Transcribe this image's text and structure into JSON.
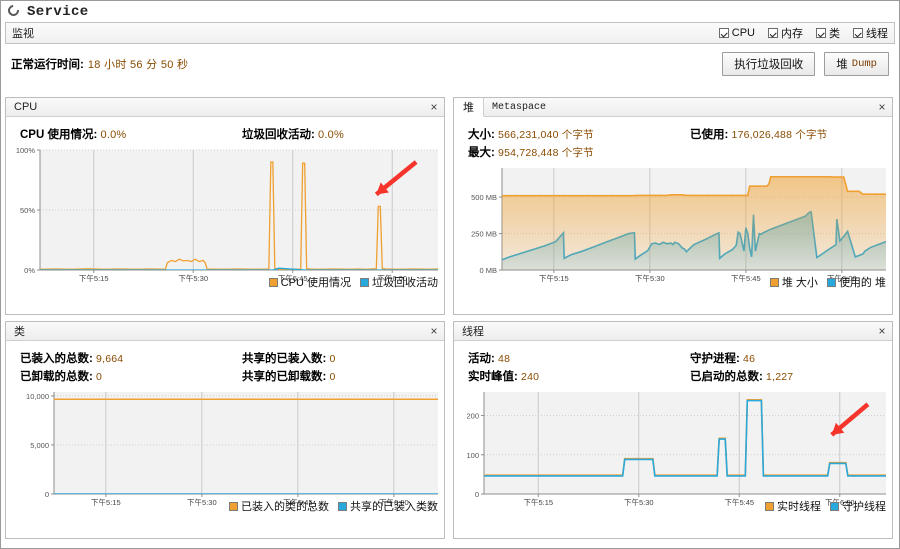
{
  "window": {
    "title": "Service",
    "icon": "process-circle-icon"
  },
  "monitor_bar": {
    "title": "监视",
    "checkboxes": [
      {
        "label": "CPU",
        "checked": true
      },
      {
        "label": "内存",
        "checked": true
      },
      {
        "label": "类",
        "checked": true
      },
      {
        "label": "线程",
        "checked": true
      }
    ]
  },
  "uptime": {
    "label": "正常运行时间:",
    "value": "18 小时 56 分 50 秒"
  },
  "toolbar": {
    "gc_button": "执行垃圾回收",
    "heap_dump_button": "堆",
    "heap_dump_button_mono": "Dump"
  },
  "colors": {
    "orange": "#f0a030",
    "orange_line": "#e8971c",
    "blue": "#29a8db",
    "blue_line": "#1f9ed4",
    "arrow_red": "#f5342b",
    "value_text": "#8a4b00",
    "plot_bg": "#f2f2f2",
    "grid": "#d8d8d8"
  },
  "panels": {
    "cpu": {
      "header": "CPU",
      "close": "×",
      "stats": [
        {
          "label": "CPU 使用情况:",
          "value": "0.0%"
        },
        {
          "label": "垃圾回收活动:",
          "value": "0.0%"
        }
      ],
      "legend": [
        {
          "label": "CPU 使用情况",
          "color": "#f0a030"
        },
        {
          "label": "垃圾回收活动",
          "color": "#29a8db"
        }
      ]
    },
    "heap": {
      "tab_active": "堆",
      "tab_inactive": "Metaspace",
      "close": "×",
      "stats": [
        {
          "label": "大小:",
          "value": "566,231,040 个字节"
        },
        {
          "label": "已使用:",
          "value": "176,026,488 个字节"
        },
        {
          "label": "最大:",
          "value": "954,728,448 个字节"
        },
        {
          "label": "",
          "value": ""
        }
      ],
      "legend": [
        {
          "label": "堆 大小",
          "color": "#f0a030"
        },
        {
          "label": "使用的 堆",
          "color": "#29a8db"
        }
      ]
    },
    "classes": {
      "header": "类",
      "close": "×",
      "stats": [
        {
          "label": "已装入的总数:",
          "value": "9,664"
        },
        {
          "label": "共享的已装入数:",
          "value": "0"
        },
        {
          "label": "已卸载的总数:",
          "value": "0"
        },
        {
          "label": "共享的已卸载数:",
          "value": "0"
        }
      ],
      "legend": [
        {
          "label": "已装入的类的总数",
          "color": "#f0a030"
        },
        {
          "label": "共享的已装入类数",
          "color": "#29a8db"
        }
      ]
    },
    "threads": {
      "header": "线程",
      "close": "×",
      "stats": [
        {
          "label": "活动:",
          "value": "48"
        },
        {
          "label": "守护进程:",
          "value": "46"
        },
        {
          "label": "实时峰值:",
          "value": "240"
        },
        {
          "label": "已启动的总数:",
          "value": "1,227"
        }
      ],
      "legend": [
        {
          "label": "实时线程",
          "color": "#f0a030"
        },
        {
          "label": "守护线程",
          "color": "#29a8db"
        }
      ]
    }
  },
  "chart_data": [
    {
      "id": "cpu",
      "type": "area",
      "title": "CPU",
      "xlabel": "",
      "ylabel": "",
      "ytick_labels": [
        "0%",
        "50%",
        "100%"
      ],
      "ytick_values": [
        0,
        50,
        100
      ],
      "ylim": [
        0,
        100
      ],
      "xtick_labels": [
        "下午5:15",
        "下午5:30",
        "下午5:45",
        "下午6:00"
      ],
      "xtick_positions": [
        0.135,
        0.385,
        0.635,
        0.885
      ],
      "grid": true,
      "legend_position": "bottom-right",
      "series": [
        {
          "name": "CPU 使用情况",
          "color": "#f0a030",
          "x": [
            0.0,
            0.04,
            0.08,
            0.12,
            0.16,
            0.2,
            0.24,
            0.28,
            0.315,
            0.32,
            0.33,
            0.34,
            0.35,
            0.36,
            0.37,
            0.38,
            0.39,
            0.4,
            0.41,
            0.415,
            0.42,
            0.46,
            0.5,
            0.54,
            0.575,
            0.58,
            0.585,
            0.59,
            0.6,
            0.605,
            0.61,
            0.62,
            0.63,
            0.655,
            0.66,
            0.665,
            0.67,
            0.68,
            0.7,
            0.74,
            0.78,
            0.8,
            0.82,
            0.845,
            0.85,
            0.855,
            0.86,
            0.87,
            0.9,
            0.94,
            0.98,
            1.0
          ],
          "y": [
            0.6,
            0.8,
            0.6,
            1.0,
            0.6,
            0.8,
            0.6,
            0.8,
            0.6,
            6.0,
            8.0,
            7.0,
            9.0,
            7.5,
            8.0,
            7.0,
            9.0,
            7.0,
            8.0,
            6.0,
            0.8,
            0.6,
            0.8,
            0.6,
            0.8,
            90.0,
            90.0,
            1.2,
            0.6,
            0.8,
            0.6,
            0.8,
            0.6,
            0.8,
            89.0,
            89.0,
            1.0,
            0.8,
            0.6,
            0.8,
            0.6,
            0.8,
            0.6,
            1.0,
            53.0,
            53.0,
            1.2,
            0.8,
            0.6,
            0.8,
            0.6,
            0.8
          ]
        },
        {
          "name": "垃圾回收活动",
          "color": "#29a8db",
          "x": [
            0.0,
            0.25,
            0.5,
            0.585,
            0.6,
            0.665,
            0.75,
            0.85,
            1.0
          ],
          "y": [
            0.0,
            0.0,
            0.0,
            0.0,
            1.5,
            0.0,
            0.0,
            0.0,
            0.0
          ]
        }
      ],
      "annotations": [
        {
          "type": "arrow",
          "color": "#f5342b",
          "from": [
            0.945,
            0.9
          ],
          "to": [
            0.845,
            0.63
          ]
        }
      ]
    },
    {
      "id": "heap",
      "type": "area",
      "title": "堆",
      "ytick_labels": [
        "0 MB",
        "250 MB",
        "500 MB"
      ],
      "ytick_values": [
        0,
        250,
        500
      ],
      "ylim": [
        0,
        700
      ],
      "xtick_labels": [
        "下午5:15",
        "下午5:30",
        "下午5:45",
        "下午6:00"
      ],
      "xtick_positions": [
        0.135,
        0.385,
        0.635,
        0.885
      ],
      "grid": true,
      "legend_position": "bottom-right",
      "series": [
        {
          "name": "堆 大小",
          "color": "#f0a030",
          "x": [
            0.0,
            0.1,
            0.2,
            0.3,
            0.345,
            0.35,
            0.4,
            0.43,
            0.44,
            0.47,
            0.48,
            0.52,
            0.56,
            0.595,
            0.6,
            0.605,
            0.64,
            0.645,
            0.65,
            0.69,
            0.695,
            0.7,
            0.76,
            0.8,
            0.84,
            0.845,
            0.85,
            0.855,
            0.86,
            0.89,
            0.9,
            0.93,
            0.94,
            1.0
          ],
          "y": [
            510,
            510,
            510,
            510,
            510,
            512,
            512,
            512,
            516,
            516,
            512,
            512,
            512,
            512,
            512,
            512,
            512,
            575,
            575,
            575,
            590,
            640,
            640,
            640,
            640,
            640,
            640,
            640,
            638,
            638,
            540,
            540,
            520,
            520
          ]
        },
        {
          "name": "使用的 堆",
          "color": "#29a8db",
          "x": [
            0.0,
            0.02,
            0.05,
            0.08,
            0.11,
            0.14,
            0.16,
            0.162,
            0.18,
            0.21,
            0.24,
            0.27,
            0.3,
            0.33,
            0.345,
            0.347,
            0.36,
            0.375,
            0.38,
            0.39,
            0.4,
            0.41,
            0.42,
            0.43,
            0.44,
            0.445,
            0.45,
            0.46,
            0.47,
            0.475,
            0.48,
            0.49,
            0.5,
            0.53,
            0.56,
            0.565,
            0.567,
            0.58,
            0.6,
            0.61,
            0.615,
            0.62,
            0.63,
            0.635,
            0.64,
            0.645,
            0.65,
            0.655,
            0.66,
            0.67,
            0.675,
            0.68,
            0.7,
            0.73,
            0.76,
            0.79,
            0.8,
            0.805,
            0.82,
            0.85,
            0.87,
            0.872,
            0.88,
            0.89,
            0.9,
            0.92,
            0.94,
            0.945,
            0.96,
            0.98,
            1.0
          ],
          "y": [
            70,
            90,
            115,
            140,
            165,
            195,
            255,
            80,
            105,
            130,
            160,
            190,
            220,
            250,
            255,
            75,
            100,
            125,
            135,
            180,
            185,
            175,
            190,
            180,
            185,
            175,
            190,
            180,
            150,
            145,
            125,
            150,
            175,
            210,
            250,
            255,
            80,
            110,
            140,
            170,
            260,
            250,
            130,
            290,
            250,
            150,
            90,
            380,
            130,
            250,
            245,
            255,
            280,
            310,
            340,
            370,
            395,
            400,
            85,
            140,
            175,
            350,
            200,
            230,
            265,
            90,
            110,
            130,
            155,
            175,
            195
          ]
        }
      ]
    },
    {
      "id": "classes",
      "type": "line",
      "title": "类",
      "ytick_labels": [
        "0",
        "5,000",
        "10,000"
      ],
      "ytick_values": [
        0,
        5000,
        10000
      ],
      "ylim": [
        0,
        10400
      ],
      "xtick_labels": [
        "下午5:15",
        "下午5:30",
        "下午5:45",
        "下午6:00"
      ],
      "xtick_positions": [
        0.135,
        0.385,
        0.635,
        0.885
      ],
      "grid": true,
      "legend_position": "bottom-right",
      "series": [
        {
          "name": "已装入的类的总数",
          "color": "#f0a030",
          "x": [
            0.0,
            1.0
          ],
          "y": [
            9664,
            9664
          ]
        },
        {
          "name": "共享的已装入类数",
          "color": "#29a8db",
          "x": [
            0.0,
            1.0
          ],
          "y": [
            0,
            0
          ]
        }
      ]
    },
    {
      "id": "threads",
      "type": "line",
      "title": "线程",
      "ytick_labels": [
        "0",
        "100",
        "200"
      ],
      "ytick_values": [
        0,
        100,
        200
      ],
      "ylim": [
        0,
        260
      ],
      "xtick_labels": [
        "下午5:15",
        "下午5:30",
        "下午5:45",
        "下午6:00"
      ],
      "xtick_positions": [
        0.135,
        0.385,
        0.635,
        0.885
      ],
      "grid": true,
      "legend_position": "bottom-right",
      "series": [
        {
          "name": "实时线程",
          "color": "#f0a030",
          "x": [
            0.0,
            0.1,
            0.2,
            0.3,
            0.345,
            0.35,
            0.42,
            0.425,
            0.5,
            0.58,
            0.585,
            0.6,
            0.605,
            0.62,
            0.65,
            0.655,
            0.69,
            0.695,
            0.75,
            0.8,
            0.855,
            0.86,
            0.9,
            0.905,
            0.95,
            1.0
          ],
          "y": [
            48,
            48,
            48,
            48,
            48,
            90,
            90,
            48,
            48,
            48,
            142,
            142,
            48,
            48,
            48,
            240,
            240,
            48,
            48,
            48,
            48,
            80,
            80,
            48,
            48,
            48
          ]
        },
        {
          "name": "守护线程",
          "color": "#29a8db",
          "x": [
            0.0,
            0.1,
            0.2,
            0.3,
            0.345,
            0.35,
            0.42,
            0.425,
            0.5,
            0.58,
            0.585,
            0.6,
            0.605,
            0.62,
            0.65,
            0.655,
            0.69,
            0.695,
            0.75,
            0.8,
            0.855,
            0.86,
            0.9,
            0.905,
            0.95,
            1.0
          ],
          "y": [
            46,
            46,
            46,
            46,
            46,
            88,
            88,
            46,
            46,
            46,
            140,
            140,
            46,
            46,
            46,
            238,
            238,
            46,
            46,
            46,
            46,
            78,
            78,
            46,
            46,
            46
          ]
        }
      ],
      "annotations": [
        {
          "type": "arrow",
          "color": "#f5342b",
          "from": [
            0.955,
            0.88
          ],
          "to": [
            0.865,
            0.58
          ]
        }
      ]
    }
  ]
}
